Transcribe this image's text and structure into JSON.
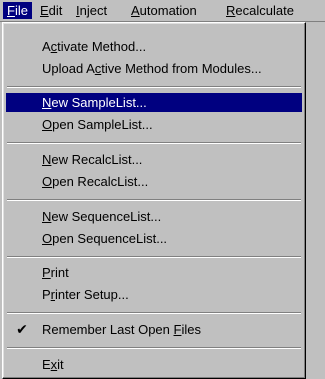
{
  "menubar": {
    "items": [
      {
        "pre": "",
        "acc": "F",
        "post": "ile"
      },
      {
        "pre": "",
        "acc": "E",
        "post": "dit"
      },
      {
        "pre": "",
        "acc": "I",
        "post": "nject"
      },
      {
        "pre": "",
        "acc": "A",
        "post": "utomation"
      },
      {
        "pre": "",
        "acc": "R",
        "post": "ecalculate"
      }
    ]
  },
  "file_menu": {
    "activate_method": {
      "pre": "A",
      "acc": "c",
      "post": "tivate Method..."
    },
    "upload_active_method": {
      "pre": "Upload A",
      "acc": "c",
      "post": "tive Method from Modules..."
    },
    "new_samplelist": {
      "pre": "",
      "acc": "N",
      "post": "ew SampleList..."
    },
    "open_samplelist": {
      "pre": "",
      "acc": "O",
      "post": "pen SampleList..."
    },
    "new_recalclist": {
      "pre": "",
      "acc": "N",
      "post": "ew RecalcList..."
    },
    "open_recalclist": {
      "pre": "",
      "acc": "O",
      "post": "pen RecalcList..."
    },
    "new_sequencelist": {
      "pre": "",
      "acc": "N",
      "post": "ew SequenceList..."
    },
    "open_sequencelist": {
      "pre": "",
      "acc": "O",
      "post": "pen SequenceList..."
    },
    "print": {
      "pre": "",
      "acc": "P",
      "post": "rint"
    },
    "printer_setup": {
      "pre": "P",
      "acc": "r",
      "post": "inter Setup..."
    },
    "remember_last_open_files": {
      "pre": "Remember Last Open ",
      "acc": "F",
      "post": "iles",
      "checked": true,
      "check_glyph": "✔"
    },
    "exit": {
      "pre": "E",
      "acc": "x",
      "post": "it"
    }
  }
}
